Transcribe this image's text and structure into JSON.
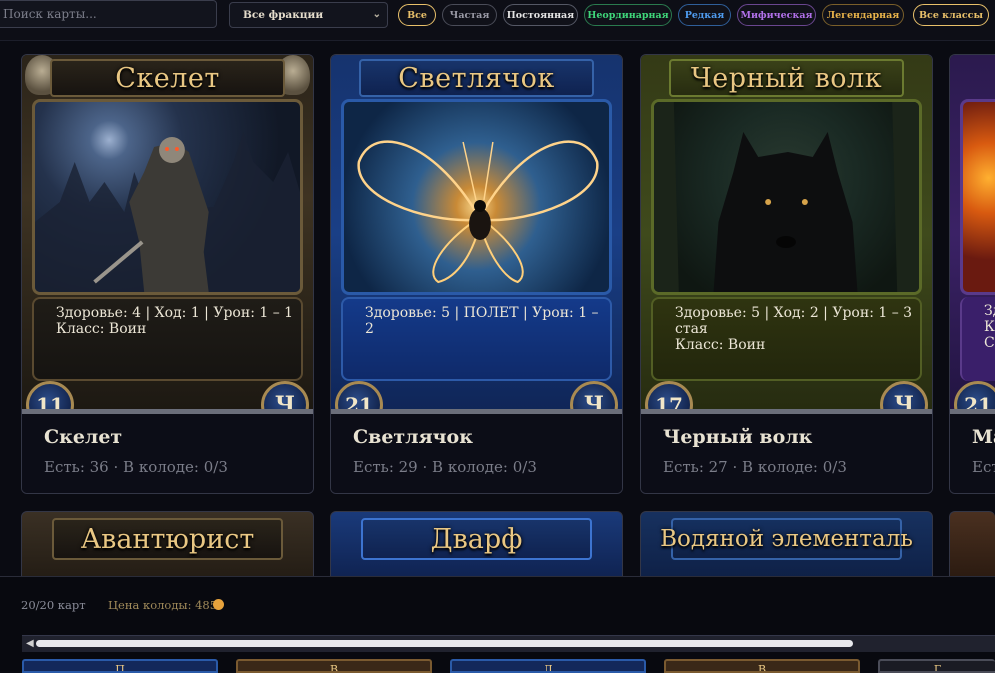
{
  "filters": {
    "search_placeholder": "Поиск карты...",
    "faction_select": "Все фракции",
    "rarity_chips": [
      {
        "label": "Все",
        "color": "#e8c06a"
      },
      {
        "label": "Частая",
        "color": "#9a9aa6"
      },
      {
        "label": "Постоянная",
        "color": "#e4e4e4"
      },
      {
        "label": "Неординарная",
        "color": "#3fd67a"
      },
      {
        "label": "Редкая",
        "color": "#4f9cf0"
      },
      {
        "label": "Мифическая",
        "color": "#b070e8"
      },
      {
        "label": "Легендарная",
        "color": "#e8b34a"
      }
    ],
    "class_select": "Все классы"
  },
  "cards": [
    {
      "title": "Скелет",
      "stats": [
        "Здоровье: 4 | Ход: 1 | Урон: 1 – 1",
        "Класс: Воин"
      ],
      "cost": "11",
      "rarity_badge": "Ч",
      "name": "Скелет",
      "meta": "Есть: 36 · В колоде: 0/3",
      "frame_color": "#6b5a3a",
      "image_icon": "armored-skeleton-image"
    },
    {
      "title": "Светлячок",
      "stats": [
        "Здоровье: 5 | ПОЛЕТ | Урон: 1 – 2"
      ],
      "cost": "21",
      "rarity_badge": "Ч",
      "name": "Светлячок",
      "meta": "Есть: 29 · В колоде: 0/3",
      "frame_color": "#1f4a9a",
      "image_icon": "glowing-firefly-image"
    },
    {
      "title": "Черный волк",
      "stats": [
        "Здоровье: 5 | Ход: 2 | Урон: 1 – 3",
        "стая",
        "Класс: Воин"
      ],
      "cost": "17",
      "rarity_badge": "Ч",
      "name": "Черный волк",
      "meta": "Есть: 27 · В колоде: 0/3",
      "frame_color": "#4f5a22",
      "image_icon": "black-wolf-image"
    },
    {
      "title": "",
      "stats": [
        "Зд",
        "К",
        "Сі"
      ],
      "cost": "21",
      "rarity_badge": "",
      "name": "Ма",
      "meta": "Ест",
      "frame_color": "#3b2266",
      "image_icon": "fire-mage-image"
    }
  ],
  "row2_cards": [
    {
      "title": "Авантюрист",
      "frame_color": "#5e4e34"
    },
    {
      "title": "Дварф",
      "frame_color": "#1e4488"
    },
    {
      "title": "Водяной элементаль",
      "frame_color": "#1e3f78"
    },
    {
      "title": "",
      "frame_color": "#4a3020"
    }
  ],
  "deck": {
    "count": "20/20 карт",
    "price_label": "Цена колоды: 485",
    "mini_cards": [
      "П",
      "В",
      "Л",
      "В",
      "Г"
    ]
  }
}
